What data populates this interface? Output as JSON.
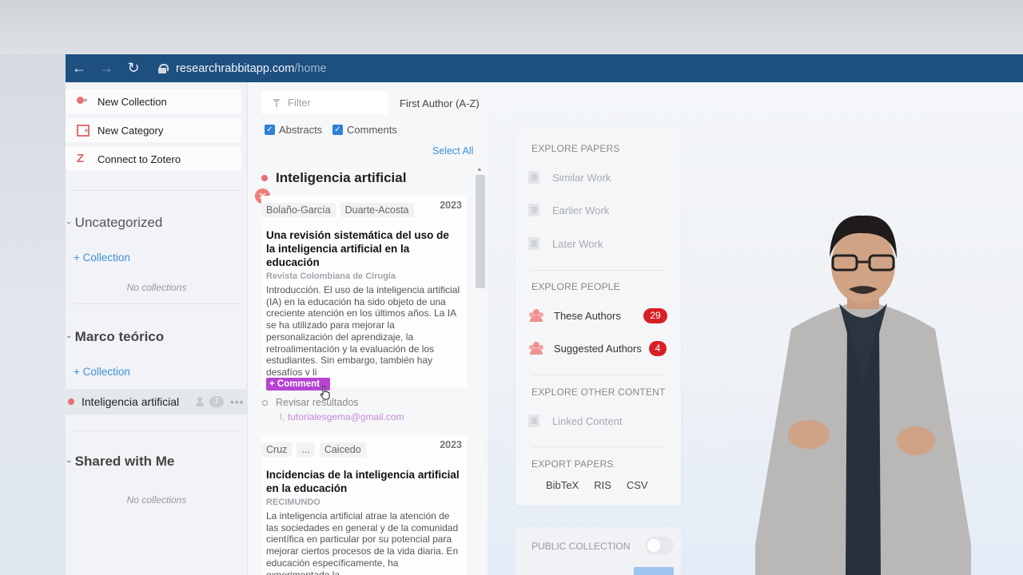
{
  "browser": {
    "back_icon": "←",
    "forward_icon": "→",
    "reload_icon": "↻",
    "url_host": "researchrabbitapp.com",
    "url_path": "/home"
  },
  "sidebar": {
    "new_collection": "New Collection",
    "new_category": "New Category",
    "connect_zotero": "Connect to Zotero",
    "zotero_glyph": "Z",
    "sections": [
      {
        "title": "Uncategorized",
        "add_label": "+ Collection",
        "empty": "No collections"
      },
      {
        "title": "Marco teórico",
        "add_label": "+ Collection"
      },
      {
        "title": "Shared with Me",
        "empty": "No collections"
      }
    ],
    "active_collection": {
      "label": "Inteligencia artificial",
      "count": "7",
      "more": "•••"
    }
  },
  "papers": {
    "filter_placeholder": "Filter",
    "sort_label": "First Author (A-Z)",
    "abstracts_label": "Abstracts",
    "comments_label": "Comments",
    "select_all": "Select All",
    "collection_title": "Inteligencia artificial",
    "close_glyph": "✕",
    "items": [
      {
        "authors": [
          "Bolaño-García",
          "Duarte-Acosta"
        ],
        "year": "2023",
        "title": "Una revisión sistemática del uso de la inteligencia artificial en la educación",
        "journal": "Revista Colombiana de Cirugía",
        "abstract": "Introducción. El uso de la inteligencia artificial (IA) en la educación ha sido objeto de una creciente atención en los últimos años. La IA se ha utilizado para mejorar la personalización del aprendizaje, la retroalimentación y la evaluación de los estudiantes. Sin embargo, también hay desafíos y li",
        "comment_button": "+ Comment",
        "todo": "Revisar resultados",
        "email": "tutorialesgema@gmail.com"
      },
      {
        "authors": [
          "Cruz",
          "...",
          "Caicedo"
        ],
        "year": "2023",
        "title": "Incidencias de la inteligencia artificial en la educación",
        "journal": "RECIMUNDO",
        "abstract": "La inteligencia artificial atrae la atención de las sociedades en general y de la comunidad científica en particular por su potencial para mejorar ciertos procesos de la vida diaria. En educación específicamente, ha experimentado la"
      }
    ]
  },
  "explore": {
    "papers_head": "EXPLORE PAPERS",
    "similar": "Similar Work",
    "earlier": "Earlier Work",
    "later": "Later Work",
    "people_head": "EXPLORE PEOPLE",
    "these_authors": "These Authors",
    "these_authors_count": "29",
    "suggested_authors": "Suggested Authors",
    "suggested_authors_count": "4",
    "other_head": "EXPLORE OTHER CONTENT",
    "linked": "Linked Content",
    "export_head": "EXPORT PAPERS",
    "bibtex": "BibTeX",
    "ris": "RIS",
    "csv": "CSV",
    "public_collection": "PUBLIC COLLECTION"
  },
  "colors": {
    "browser_bar": "#1d4f7f",
    "accent_blue": "#3f8fd8",
    "collection_dot": "#e76f6f",
    "comment_purple": "#b743d3",
    "badge_red": "#d81f26"
  }
}
